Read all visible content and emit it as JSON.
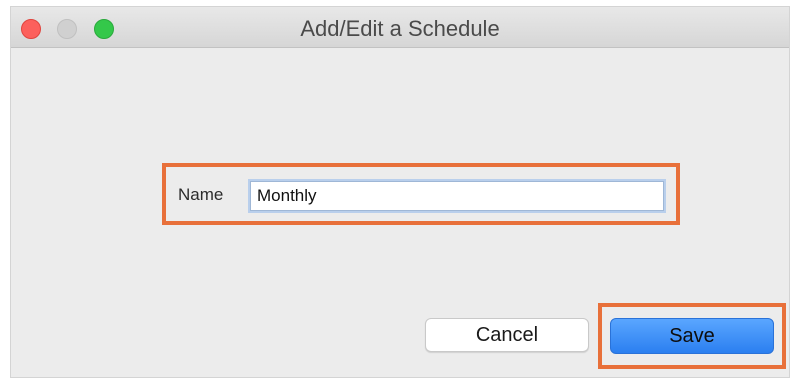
{
  "window": {
    "title": "Add/Edit a Schedule"
  },
  "form": {
    "name_label": "Name",
    "name_value": "Monthly"
  },
  "buttons": {
    "cancel_label": "Cancel",
    "save_label": "Save"
  },
  "colors": {
    "highlight": "#e8703a",
    "save_button": "#2b7ff0",
    "close": "#fc605c",
    "zoom": "#34c84a"
  }
}
